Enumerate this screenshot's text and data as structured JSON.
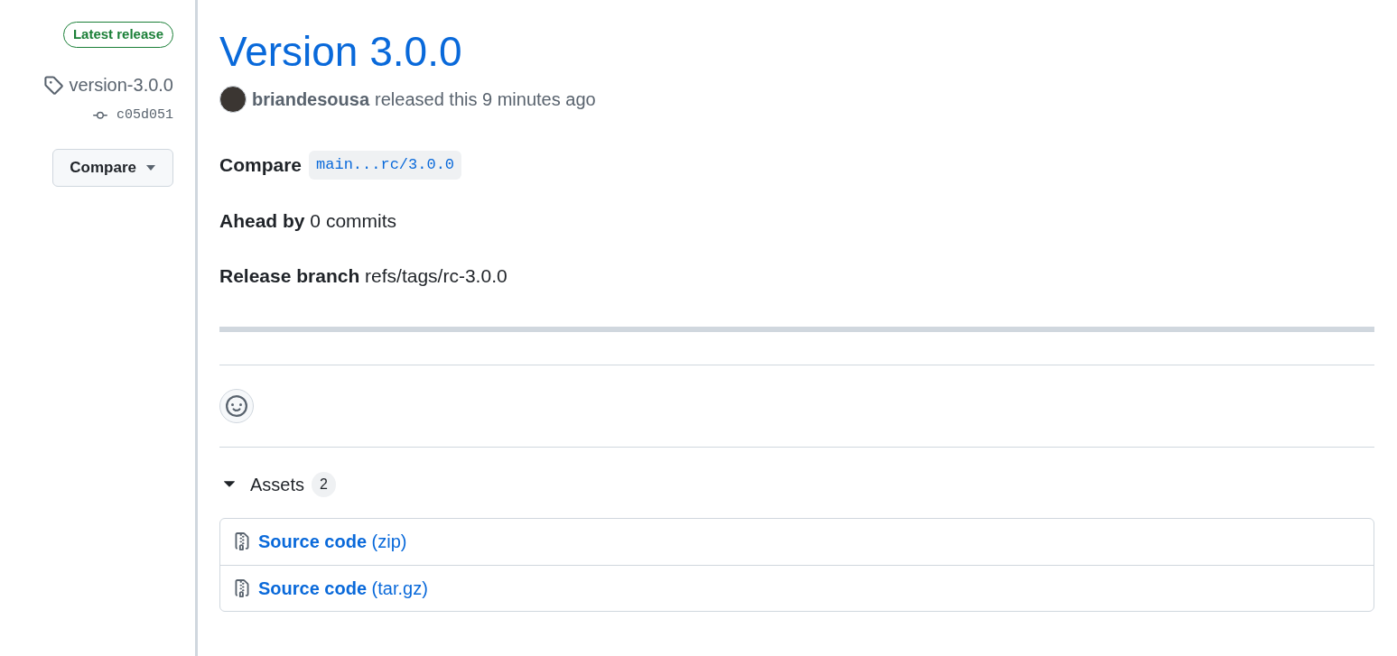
{
  "sidebar": {
    "badge": "Latest release",
    "tag": "version-3.0.0",
    "commit": "c05d051",
    "compare_button": "Compare"
  },
  "release": {
    "title": "Version 3.0.0",
    "author": "briandesousa",
    "released": "released this 9 minutes ago",
    "compare": {
      "label": "Compare",
      "range": "main...rc/3.0.0"
    },
    "details": [
      "**Ahead by** 0 commits",
      "**Release branch** refs/tags/rc-3.0.0"
    ]
  },
  "assets": {
    "label": "Assets",
    "count": "2",
    "expanded": true,
    "items": [
      "**Source code** (zip)",
      "**Source code** (tar.gz)"
    ]
  }
}
